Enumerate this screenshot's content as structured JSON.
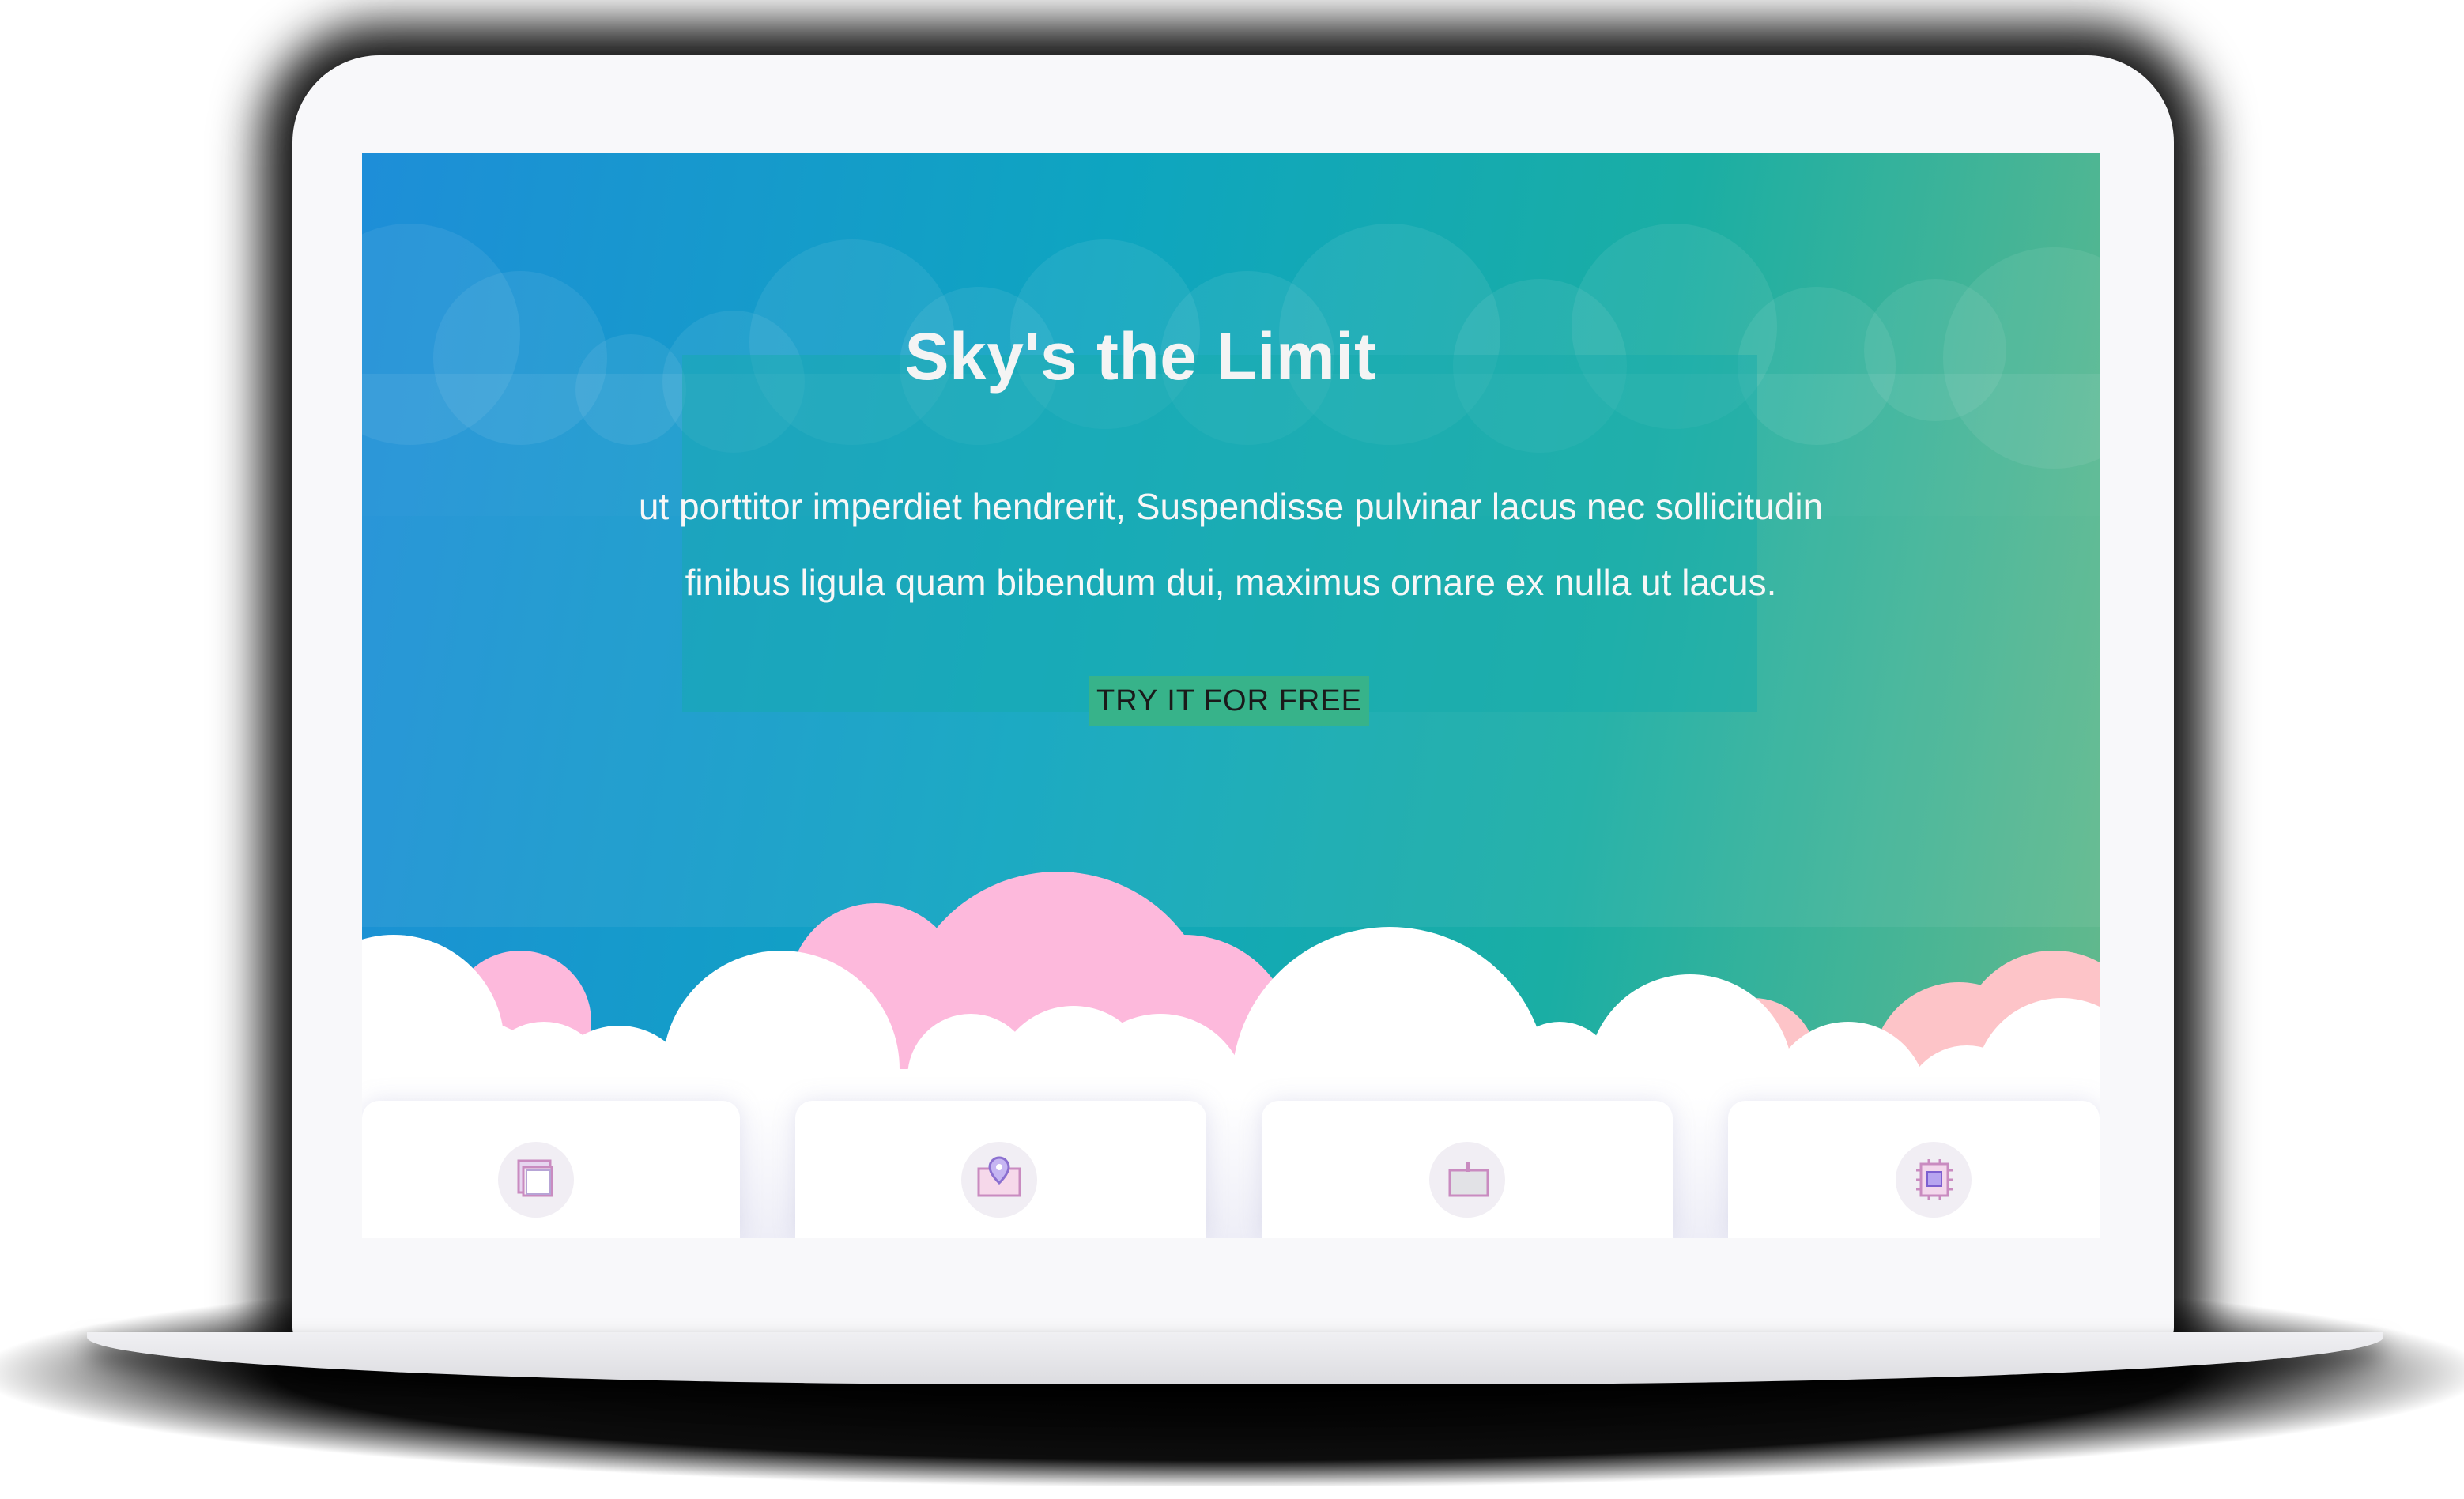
{
  "hero": {
    "title": "Sky's the Limit",
    "text_line1": "ut porttitor imperdiet hendrerit, Suspendisse pulvinar lacus nec sollicitudin",
    "text_line2": "finibus ligula quam bibendum dui, maximus ornare ex nulla ut lacus.",
    "cta_label": "TRY IT FOR FREE"
  },
  "colors": {
    "gradient_start": "#1e8ed8",
    "gradient_end": "#64b98c",
    "cta_background": "#37b38a",
    "cloud_pink": "#fdb9dc",
    "cloud_peach": "#fdc4c8"
  },
  "features": [
    {
      "icon": "layers-icon"
    },
    {
      "icon": "location-pin-icon"
    },
    {
      "icon": "browser-window-icon"
    },
    {
      "icon": "cpu-chip-icon"
    }
  ]
}
